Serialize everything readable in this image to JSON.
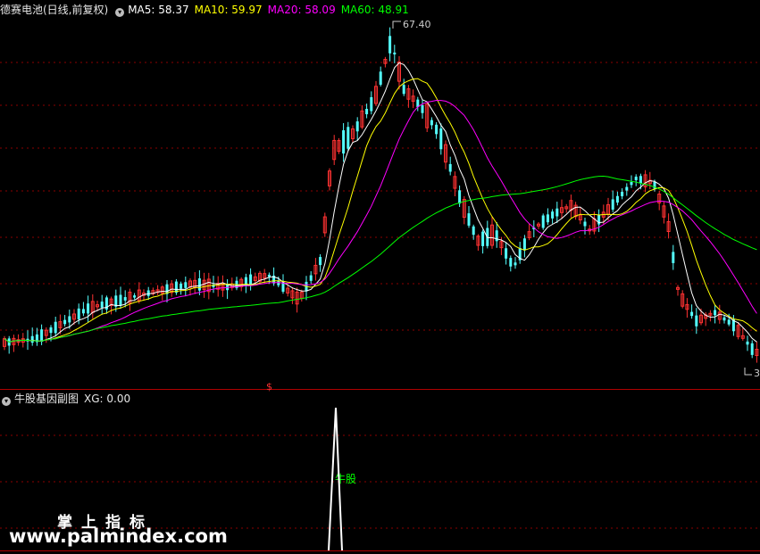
{
  "header": {
    "title": "德赛电池(日线,前复权)",
    "ma": [
      {
        "label": "MA5: 58.37",
        "color": "#ffffff"
      },
      {
        "label": "MA10: 59.97",
        "color": "#ffff00"
      },
      {
        "label": "MA20: 58.09",
        "color": "#ff00ff"
      },
      {
        "label": "MA60: 48.91",
        "color": "#00ff00"
      }
    ]
  },
  "price_chart": {
    "high_label": "67.40",
    "low_label": "3",
    "signal_mark": "$"
  },
  "indicator": {
    "title": "牛股基因副图",
    "xg_label": "XG: 0.00",
    "peak_label": "牛股"
  },
  "watermark": {
    "line1": "掌上指标",
    "line2": "www.palmindex.com"
  },
  "colors": {
    "bull": "#ff3232",
    "bear": "#54ffff",
    "ma5": "#ffffff",
    "ma10": "#ffff00",
    "ma20": "#ff00ff",
    "ma60": "#00ff00",
    "grid": "#8b0000"
  }
}
